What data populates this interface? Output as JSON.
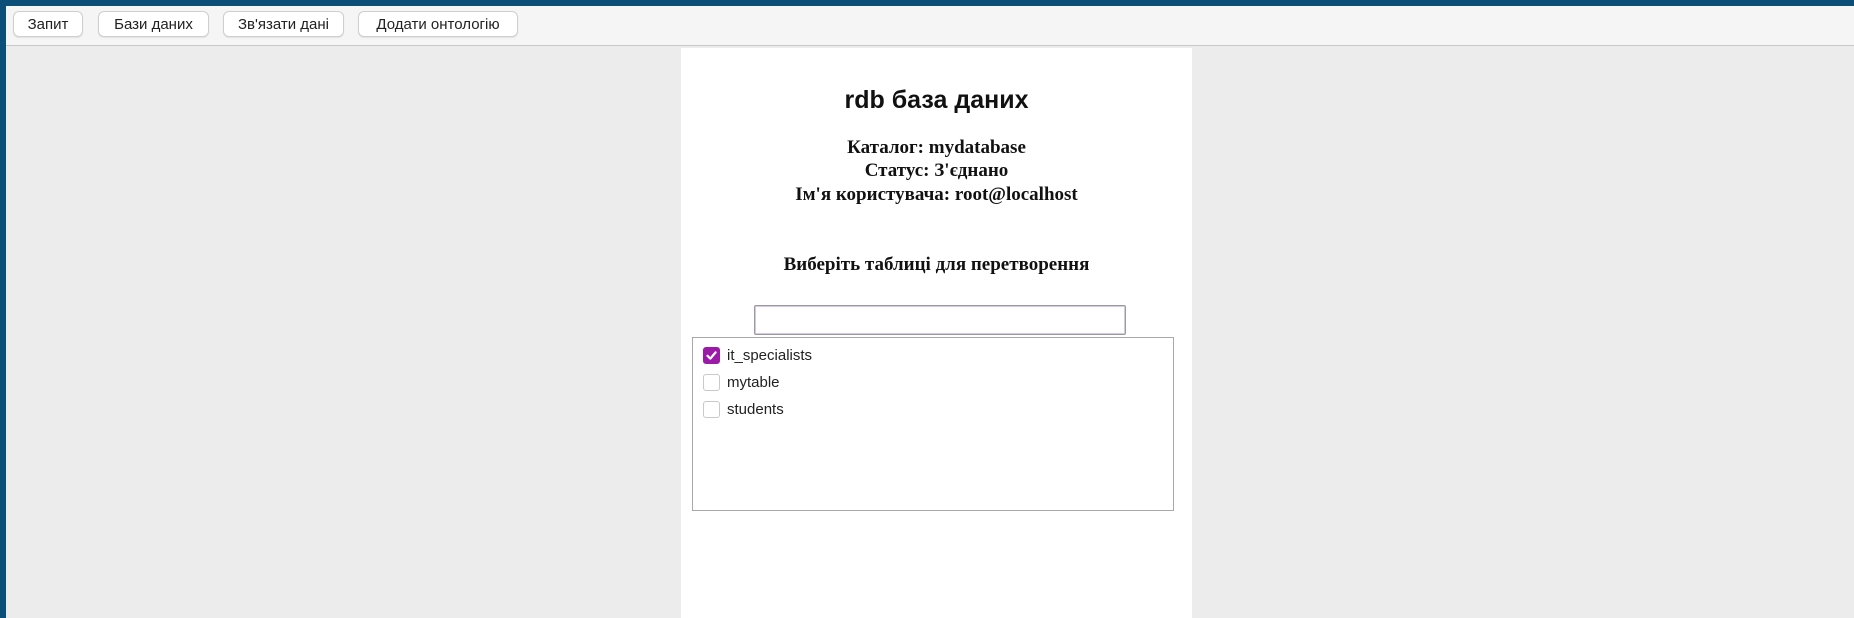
{
  "toolbar": {
    "buttons": [
      "Запит",
      "Бази даних",
      "Зв'язати дані",
      "Додати онтологію"
    ]
  },
  "panel": {
    "title": "rdb база даних",
    "catalog": "Каталог: mydatabase",
    "status": "Статус: З'єднано",
    "username": "Ім'я користувача: root@localhost",
    "subtitle": "Виберіть таблиці для перетворення",
    "search_value": "",
    "tables": [
      {
        "name": "it_specialists",
        "checked": true
      },
      {
        "name": "mytable",
        "checked": false
      },
      {
        "name": "students",
        "checked": false
      }
    ]
  },
  "colors": {
    "frame_border": "#0b4f78",
    "background": "#ececec",
    "checkbox_accent": "#9c1aa8"
  },
  "icons": {
    "checked_box": "checkmark-icon"
  }
}
